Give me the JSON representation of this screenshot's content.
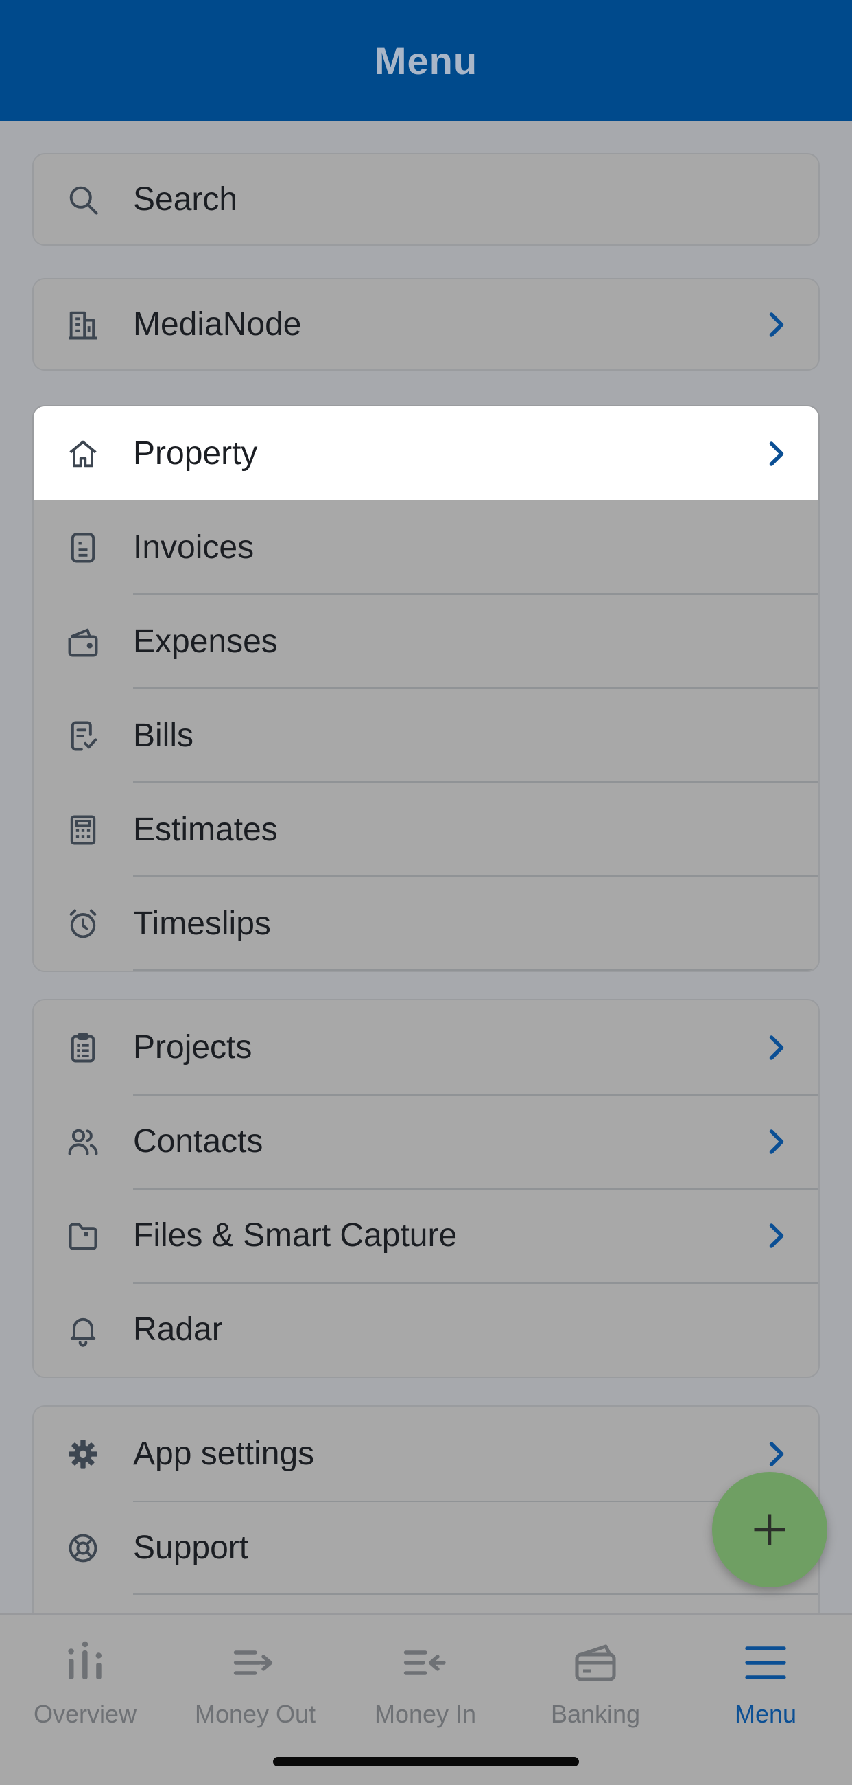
{
  "header": {
    "title": "Menu"
  },
  "search": {
    "label": "Search",
    "icon": "search-icon"
  },
  "company": {
    "label": "MediaNode",
    "icon": "building-icon"
  },
  "group_main": {
    "items": [
      {
        "label": "Property",
        "icon": "home-icon",
        "chevron": true,
        "highlighted": true
      },
      {
        "label": "Invoices",
        "icon": "document-icon",
        "chevron": false
      },
      {
        "label": "Expenses",
        "icon": "wallet-icon",
        "chevron": false
      },
      {
        "label": "Bills",
        "icon": "bill-icon",
        "chevron": false
      },
      {
        "label": "Estimates",
        "icon": "calculator-icon",
        "chevron": false
      },
      {
        "label": "Timeslips",
        "icon": "alarm-clock-icon",
        "chevron": false
      }
    ]
  },
  "group_work": {
    "items": [
      {
        "label": "Projects",
        "icon": "clipboard-icon",
        "chevron": true
      },
      {
        "label": "Contacts",
        "icon": "users-icon",
        "chevron": true
      },
      {
        "label": "Files & Smart Capture",
        "icon": "folder-icon",
        "chevron": true
      },
      {
        "label": "Radar",
        "icon": "bell-icon",
        "chevron": false
      }
    ]
  },
  "group_settings": {
    "items": [
      {
        "label": "App settings",
        "icon": "gear-icon",
        "chevron": true
      },
      {
        "label": "Support",
        "icon": "lifebuoy-icon",
        "chevron": true
      }
    ]
  },
  "fab": {
    "icon": "plus-icon"
  },
  "tabs": [
    {
      "label": "Overview",
      "icon": "bar-chart-icon",
      "active": false
    },
    {
      "label": "Money Out",
      "icon": "money-out-icon",
      "active": false
    },
    {
      "label": "Money In",
      "icon": "money-in-icon",
      "active": false
    },
    {
      "label": "Banking",
      "icon": "bank-card-icon",
      "active": false
    },
    {
      "label": "Menu",
      "icon": "hamburger-menu-icon",
      "active": true
    }
  ],
  "colors": {
    "header_bg": "#004a8c",
    "accent": "#0b4f94",
    "icon": "#3d4651",
    "fab": "#6f9f63"
  }
}
